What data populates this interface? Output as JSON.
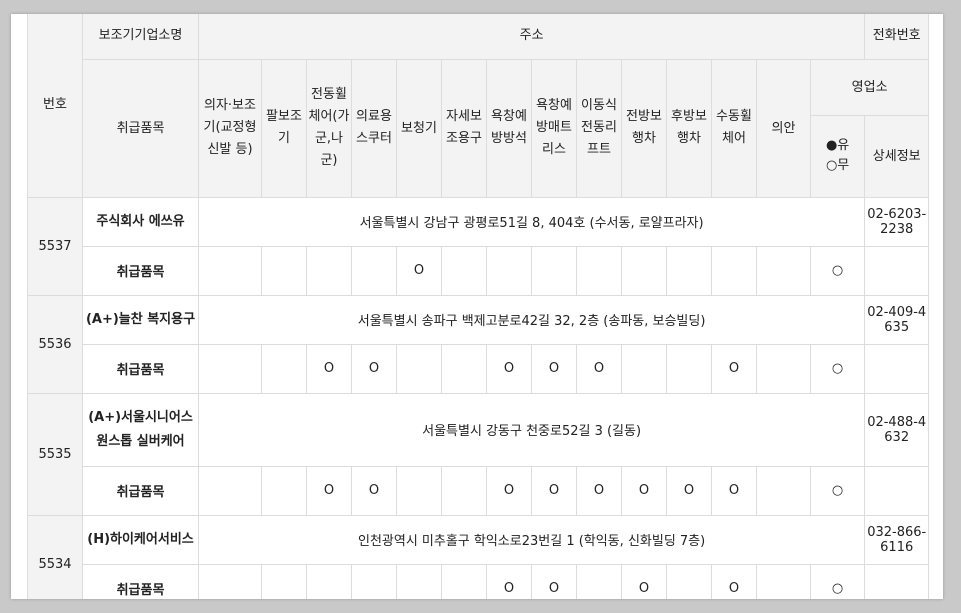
{
  "header": {
    "number": "번호",
    "company_name": "보조기기업소명",
    "address": "주소",
    "phone": "전화번호",
    "items_handled": "취급품목",
    "business_office": "영업소",
    "details": "상세정보",
    "radio_yes": "●유",
    "radio_no": "○무",
    "categories": [
      "의자·보조기(교정형 신발 등)",
      "팔보조기",
      "전동휠체어(가군,나군)",
      "의료용스쿠터",
      "보청기",
      "자세보조용구",
      "욕창예방방석",
      "욕창예방매트리스",
      "이동식전동리프트",
      "전방보행차",
      "후방보행차",
      "수동휠체어",
      "의안"
    ]
  },
  "rows": [
    {
      "number": "5537",
      "name": "주식회사 에쓰유",
      "address": "서울특별시 강남구 광평로51길 8, 404호 (수서동, 로얄프라자)",
      "phone": "02-6203-2238",
      "items_label": "취급품목",
      "items": [
        "",
        "",
        "",
        "",
        "O",
        "",
        "",
        "",
        "",
        "",
        "",
        "",
        ""
      ],
      "office": "○",
      "details": ""
    },
    {
      "number": "5536",
      "name": "(A+)늘찬 복지용구",
      "address": "서울특별시 송파구 백제고분로42길 32, 2층 (송파동, 보승빌딩)",
      "phone": "02-409-4635",
      "items_label": "취급품목",
      "items": [
        "",
        "",
        "O",
        "O",
        "",
        "",
        "O",
        "O",
        "O",
        "",
        "",
        "O",
        ""
      ],
      "office": "○",
      "details": ""
    },
    {
      "number": "5535",
      "name": "(A+)서울시니어스 원스톱 실버케어",
      "address": "서울특별시 강동구 천중로52길 3 (길동)",
      "phone": "02-488-4632",
      "items_label": "취급품목",
      "items": [
        "",
        "",
        "O",
        "O",
        "",
        "",
        "O",
        "O",
        "O",
        "O",
        "O",
        "O",
        ""
      ],
      "office": "○",
      "details": ""
    },
    {
      "number": "5534",
      "name": "(H)하이케어서비스",
      "address": "인천광역시 미추홀구 학익소로23번길 1 (학익동, 신화빌딩 7층)",
      "phone": "032-866-6116",
      "items_label": "취급품목",
      "items": [
        "",
        "",
        "",
        "",
        "",
        "",
        "O",
        "O",
        "",
        "O",
        "",
        "O",
        ""
      ],
      "office": "○",
      "details": ""
    }
  ]
}
